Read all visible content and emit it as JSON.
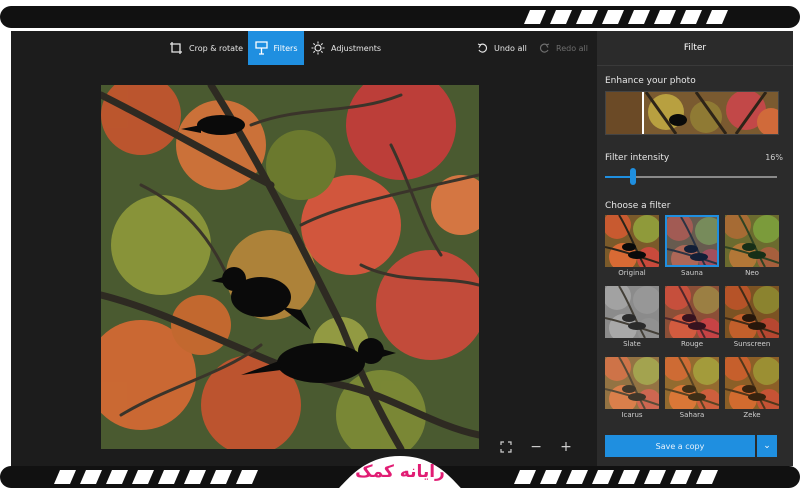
{
  "toolbar": {
    "crop": {
      "label": "Crop & rotate",
      "icon": "crop-icon"
    },
    "filters": {
      "label": "Filters",
      "icon": "filters-icon"
    },
    "adjustments": {
      "label": "Adjustments",
      "icon": "brightness-icon"
    },
    "undo": {
      "label": "Undo all",
      "icon": "undo-icon"
    },
    "redo": {
      "label": "Redo all",
      "icon": "redo-icon"
    }
  },
  "panel": {
    "title": "Filter",
    "enhance_label": "Enhance your photo",
    "intensity_label": "Filter intensity",
    "intensity_value": "16%",
    "intensity_fraction": 0.16,
    "choose_label": "Choose a filter",
    "filters": [
      {
        "name": "Original",
        "selected": false
      },
      {
        "name": "Sauna",
        "selected": true
      },
      {
        "name": "Neo",
        "selected": false
      },
      {
        "name": "Slate",
        "selected": false
      },
      {
        "name": "Rouge",
        "selected": false
      },
      {
        "name": "Sunscreen",
        "selected": false
      },
      {
        "name": "Icarus",
        "selected": false
      },
      {
        "name": "Sahara",
        "selected": false
      },
      {
        "name": "Zeke",
        "selected": false
      }
    ],
    "save_label": "Save a copy",
    "save_menu_icon": "chevron-down-icon"
  },
  "zoom": {
    "fit_icon": "fit-to-screen-icon",
    "zoom_out": "−",
    "zoom_in": "+"
  },
  "logo": {
    "text": "رایانه کمک"
  },
  "colors": {
    "accent": "#1f8fe0",
    "app_bg": "#1c1c1c",
    "panel_bg": "#2b2b2b",
    "brand": "#e11d74"
  }
}
